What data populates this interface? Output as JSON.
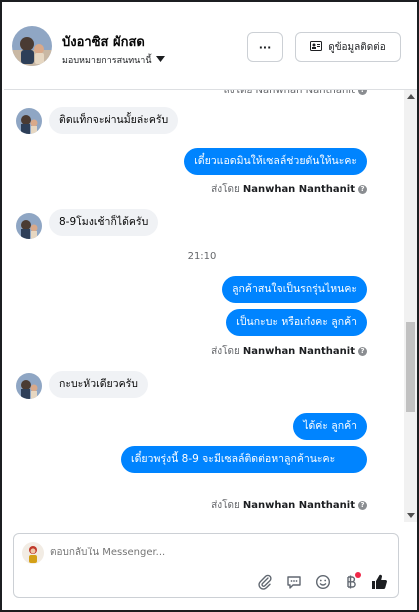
{
  "header": {
    "name": "บังอาซิส ผักสด",
    "assign_label": "มอบหมายการสนทนานี้",
    "more_label": "···",
    "contact_label": "ดูข้อมูลติดต่อ"
  },
  "messages": {
    "sent_prefix": "ส่งโดย",
    "sender": "Nanwhan Nanthanit",
    "top_partial": "ส่งโดย Nanwhan Nanthanit",
    "in1": "ติดแท็กจะผ่านมั้ยล่ะครับ",
    "out1": "เดี๋ยวแอดมินให้เซลล์ช่วยดันให้นะคะ",
    "in2": "8-9โมงเช้าก็ได้ครับ",
    "time": "21:10",
    "out2": "ลูกค้าสนใจเป็นรถรุ่นไหนคะ",
    "out3": "เป็นกะบะ หรือเก๋งคะ ลูกค้า",
    "in3": "กะบะหัวเดียวครับ",
    "out4": "ได้ค่ะ ลูกค้า",
    "out5": "เดี๋ยวพรุ่งนี้ 8-9 จะมีเซลล์ติดต่อหาลูกค้านะคะ"
  },
  "composer": {
    "placeholder": "ตอบกลับใน Messenger..."
  },
  "icons": [
    "chevron-down-icon",
    "more-icon",
    "contact-card-icon",
    "info-icon",
    "attach-icon",
    "saved-replies-icon",
    "emoji-icon",
    "baht-payment-icon",
    "like-icon"
  ],
  "colors": {
    "outgoing_bubble": "#0084ff",
    "incoming_bubble": "#f0f2f5",
    "muted_text": "#65676b",
    "notification": "#f02849"
  }
}
